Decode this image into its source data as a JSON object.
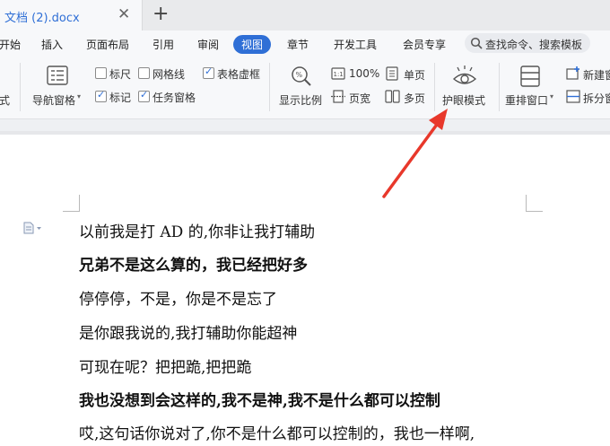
{
  "tab": {
    "title": "文档 (2).docx",
    "close": "✕",
    "new_tab": "+"
  },
  "menu": {
    "items": [
      "开始",
      "插入",
      "页面布局",
      "引用",
      "审阅",
      "视图",
      "章节",
      "开发工具",
      "会员专享"
    ],
    "active": "视图"
  },
  "search": {
    "placeholder": "查找命令、搜索模板"
  },
  "ribbon": {
    "left_partial": "式",
    "nav_pane": "导航窗格",
    "ruler": "标尺",
    "gridlines": "网格线",
    "table_gridlines": "表格虚框",
    "marks": "标记",
    "task_pane": "任务窗格",
    "zoom_label": "显示比例",
    "zoom_100": "100%",
    "page_width": "页宽",
    "single_page": "单页",
    "multi_page": "多页",
    "eye_mode": "护眼模式",
    "rearrange_window": "重排窗口",
    "new_window": "新建窗",
    "split_window": "拆分窗"
  },
  "checkbox_states": {
    "ruler": false,
    "gridlines": false,
    "table_gridlines": true,
    "marks": true,
    "task_pane": true
  },
  "accent_color": "#2f6fd6",
  "arrow_color": "#e8382b",
  "document": {
    "lines": [
      {
        "text": "以前我是打 AD 的,你非让我打辅助",
        "bold": false
      },
      {
        "text": "兄弟不是这么算的，我已经把好多",
        "bold": true
      },
      {
        "text": "停停停，不是，你是不是忘了",
        "bold": false
      },
      {
        "text": "是你跟我说的,我打辅助你能超神",
        "bold": false
      },
      {
        "text": "可现在呢？把把跪,把把跪",
        "bold": false
      },
      {
        "text": "我也没想到会这样的,我不是神,我不是什么都可以控制",
        "bold": true
      },
      {
        "text": "哎,这句话你说对了,你不是什么都可以控制的，我也一样啊,",
        "bold": false
      }
    ]
  }
}
